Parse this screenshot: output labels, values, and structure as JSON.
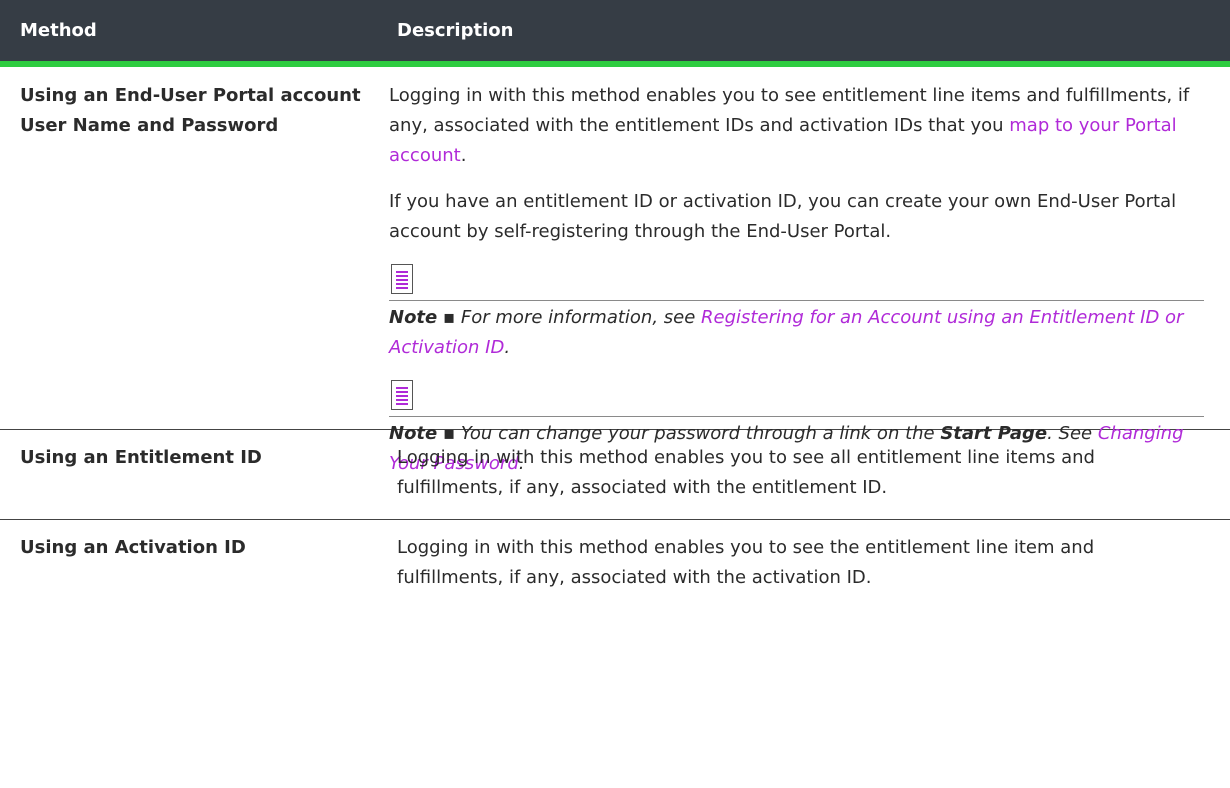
{
  "header": {
    "method": "Method",
    "description": "Description"
  },
  "rows": [
    {
      "method": "Using an End-User Portal account User Name and Password",
      "desc_p1_a": "Logging in with this method enables you to see entitlement line items and fulfillments, if any, associated with the entitlement IDs and activation IDs that you ",
      "desc_p1_link": "map to your Portal account",
      "desc_p1_b": ".",
      "desc_p2": "If you have an entitlement ID or activation ID, you can create your own End-User Portal account by self-registering through the End-User Portal.",
      "note1": {
        "label": "Note",
        "sep": " ▪ ",
        "text": "For more information, see ",
        "link": "Registering for an Account using an Entitlement ID or Activation ID",
        "end": "."
      },
      "note2": {
        "label": "Note",
        "sep": " ▪ ",
        "text_a": "You can change your password through a link on the ",
        "bold": "Start Page",
        "text_b": ". See ",
        "link": "Changing Your Password",
        "end": "."
      }
    },
    {
      "method": "Using an Entitlement ID",
      "desc": "Logging in with this method enables you to see all entitlement line items and fulfillments, if any, associated with the entitlement ID."
    },
    {
      "method": "Using an Activation ID",
      "desc": "Logging in with this method enables you to see the entitlement line item and fulfillments, if any, associated with the activation ID."
    }
  ],
  "colors": {
    "header_bg": "#363d45",
    "accent": "#2ecc40",
    "link": "#b02ad8"
  }
}
